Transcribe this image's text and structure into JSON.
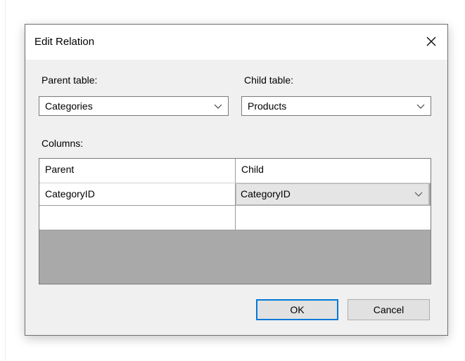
{
  "dialog": {
    "title": "Edit Relation",
    "parent_table_label": "Parent table:",
    "parent_table_value": "Categories",
    "child_table_label": "Child table:",
    "child_table_value": "Products",
    "columns_label": "Columns:",
    "grid": {
      "headers": [
        "Parent",
        "Child"
      ],
      "rows": [
        {
          "parent": "CategoryID",
          "child": "CategoryID"
        },
        {
          "parent": "",
          "child": ""
        }
      ]
    },
    "ok_label": "OK",
    "cancel_label": "Cancel"
  },
  "icons": {
    "close": "close-icon",
    "dropdown": "chevron-down-icon"
  }
}
